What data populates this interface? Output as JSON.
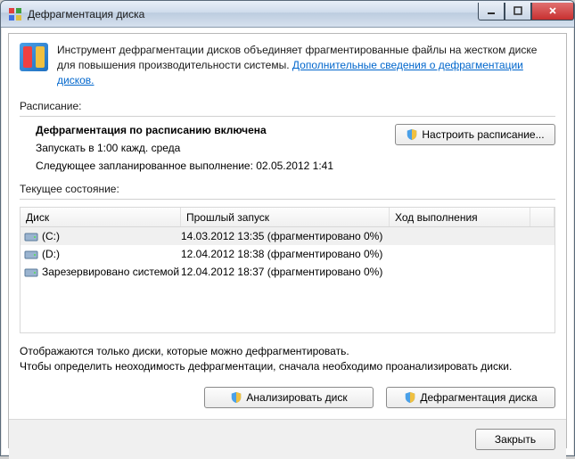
{
  "window": {
    "title": "Дефрагментация диска"
  },
  "intro": {
    "text": "Инструмент дефрагментации дисков объединяет фрагментированные файлы на жестком диске для повышения производительности системы. ",
    "link": "Дополнительные сведения о дефрагментации дисков."
  },
  "schedule": {
    "label": "Расписание:",
    "title": "Дефрагментация по расписанию включена",
    "run_at": "Запускать в 1:00 кажд. среда",
    "next": "Следующее запланированное выполнение: 02.05.2012 1:41",
    "btn": "Настроить расписание..."
  },
  "current_label": "Текущее состояние:",
  "table": {
    "headers": {
      "disk": "Диск",
      "last_run": "Прошлый запуск",
      "progress": "Ход выполнения"
    },
    "rows": [
      {
        "icon": "hdd-icon",
        "name": "(C:)",
        "last_run": "14.03.2012 13:35 (фрагментировано 0%)",
        "progress": ""
      },
      {
        "icon": "hdd-icon",
        "name": "(D:)",
        "last_run": "12.04.2012 18:38 (фрагментировано 0%)",
        "progress": ""
      },
      {
        "icon": "hdd-icon",
        "name": "Зарезервировано системой",
        "last_run": "12.04.2012 18:37 (фрагментировано 0%)",
        "progress": ""
      }
    ]
  },
  "note": {
    "line1": "Отображаются только диски, которые можно дефрагментировать.",
    "line2": "Чтобы определить неоходимость  дефрагментации, сначала необходимо проанализировать диски."
  },
  "buttons": {
    "analyze": "Анализировать диск",
    "defrag": "Дефрагментация диска",
    "close": "Закрыть"
  }
}
